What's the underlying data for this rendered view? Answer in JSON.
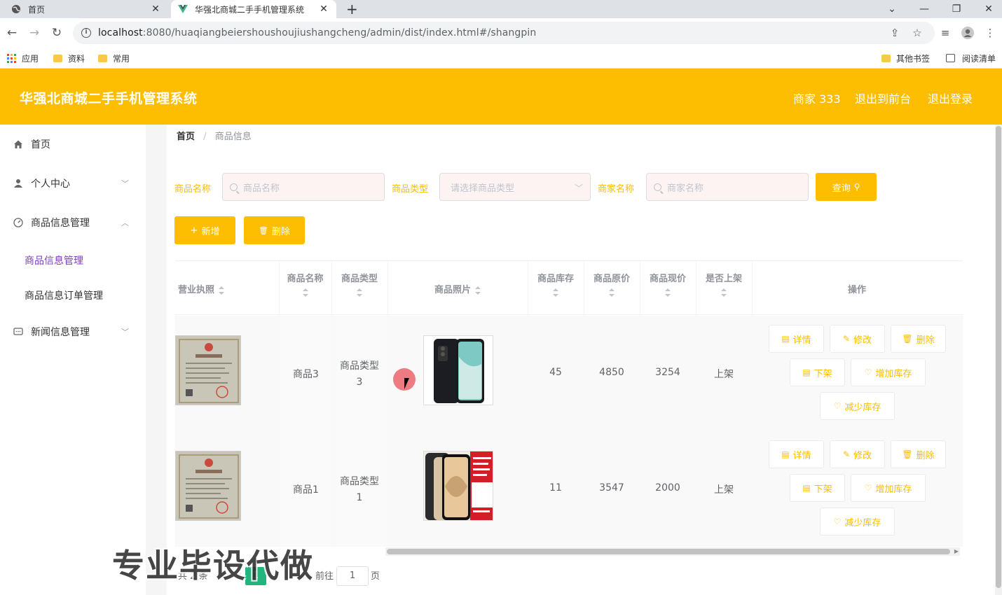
{
  "browser": {
    "tabs": [
      {
        "title": "首页",
        "active": false
      },
      {
        "title": "华强北商城二手手机管理系统",
        "active": true
      }
    ],
    "url_host": "localhost",
    "url_rest": ":8080/huaqiangbeiershoushoujiushangcheng/admin/dist/index.html#/shangpin",
    "bookmarks": [
      "应用",
      "资料",
      "常用"
    ],
    "bookmarks_right": [
      "其他书签",
      "阅读清单"
    ]
  },
  "header": {
    "title": "华强北商城二手手机管理系统",
    "user": "商家 333",
    "to_front": "退出到前台",
    "logout": "退出登录",
    "color": "#fdbd00"
  },
  "sidebar": {
    "items": [
      {
        "label": "首页",
        "icon": "home-icon"
      },
      {
        "label": "个人中心",
        "icon": "user-icon"
      },
      {
        "label": "商品信息管理",
        "icon": "gauge-icon"
      },
      {
        "label": "商品信息管理",
        "sub": true,
        "active": true
      },
      {
        "label": "商品信息订单管理",
        "sub": true
      },
      {
        "label": "新闻信息管理",
        "icon": "message-icon"
      }
    ]
  },
  "breadcrumb": {
    "home": "首页",
    "sep": "/",
    "current": "商品信息"
  },
  "filters": {
    "name_label": "商品名称",
    "name_placeholder": "商品名称",
    "type_label": "商品类型",
    "type_placeholder": "请选择商品类型",
    "merchant_label": "商家名称",
    "merchant_placeholder": "商家名称",
    "search_button": "查询"
  },
  "actions": {
    "add": "新增",
    "delete": "删除"
  },
  "table": {
    "headers": [
      "营业执照",
      "商品名称",
      "商品类型",
      "商品照片",
      "商品库存",
      "商品原价",
      "商品现价",
      "是否上架",
      "操作"
    ],
    "rows": [
      {
        "name": "商品3",
        "type_line1": "商品类型",
        "type_line2": "3",
        "stock": "45",
        "orig_price": "4850",
        "price": "3254",
        "status": "上架"
      },
      {
        "name": "商品1",
        "type_line1": "商品类型",
        "type_line2": "1",
        "stock": "11",
        "orig_price": "3547",
        "price": "2000",
        "status": "上架"
      }
    ],
    "row_buttons": {
      "detail": "详情",
      "edit": "修改",
      "delete": "删除",
      "off_shelf": "下架",
      "add_stock": "增加库存",
      "reduce_stock": "减少库存"
    }
  },
  "pagination": {
    "total": "共 2 条",
    "current_page": "1",
    "goto": "前往",
    "page_input": "1",
    "page_suffix": "页"
  },
  "watermark": "专业毕设代做"
}
